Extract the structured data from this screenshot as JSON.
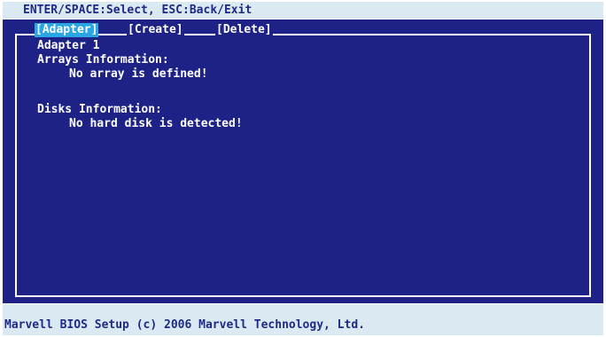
{
  "hint_bar": {
    "text": "ENTER/SPACE:Select, ESC:Back/Exit"
  },
  "tabs": [
    {
      "label": "[Adapter]",
      "active": true
    },
    {
      "label": "[Create]",
      "active": false
    },
    {
      "label": "[Delete]",
      "active": false
    }
  ],
  "content": {
    "adapter_line": "Adapter 1",
    "arrays_heading": "Arrays Information:",
    "arrays_message": "No array is defined!",
    "disks_heading": "Disks Information:",
    "disks_message": "No hard disk is detected!"
  },
  "status_bar": {
    "text": "Marvell BIOS Setup (c) 2006 Marvell Technology, Ltd."
  },
  "colors": {
    "background_blue": "#1e2287",
    "bar_background": "#dbe9f3",
    "bar_text": "#1d2a87",
    "active_tab": "#29a6e3",
    "text": "#ffffff"
  }
}
